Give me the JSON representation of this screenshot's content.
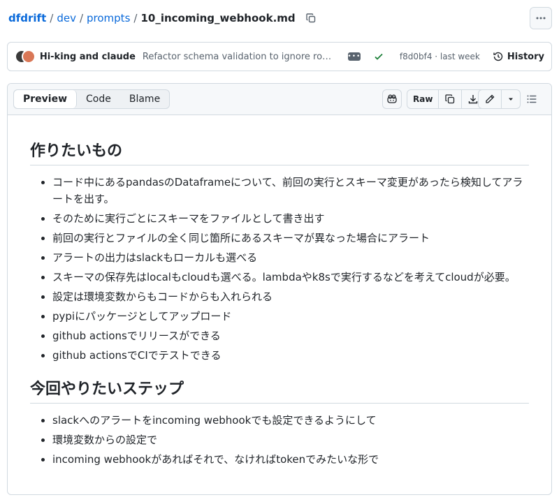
{
  "breadcrumb": {
    "owner": "dfdrift",
    "dir1": "dev",
    "dir2": "prompts",
    "file": "10_incoming_webhook.md",
    "sep": "/"
  },
  "commit": {
    "authors": "Hi-king and claude",
    "message": "Refactor schema validation to ignore row cou...",
    "sha_time": "f8d0bf4 · last week",
    "history_label": "History",
    "ellipsis": "•••"
  },
  "toolbar": {
    "tabs": [
      "Preview",
      "Code",
      "Blame"
    ],
    "raw_label": "Raw"
  },
  "content": {
    "heading1": "作りたいもの",
    "list1": [
      "コード中にあるpandasのDataframeについて、前回の実行とスキーマ変更があったら検知してアラートを出す。",
      "そのために実行ごとにスキーマをファイルとして書き出す",
      "前回の実行とファイルの全く同じ箇所にあるスキーマが異なった場合にアラート",
      "アラートの出力はslackもローカルも選べる",
      "スキーマの保存先はlocalもcloudも選べる。lambdaやk8sで実行するなどを考えてcloudが必要。",
      "設定は環境変数からもコードからも入れられる",
      "pypiにパッケージとしてアップロード",
      "github actionsでリリースができる",
      "github actionsでCIでテストできる"
    ],
    "heading2": "今回やりたいステップ",
    "list2": [
      "slackへのアラートをincoming webhookでも設定できるようにして",
      "環境変数からの設定で",
      "incoming webhookがあればそれで、なければtokenでみたいな形で"
    ]
  },
  "colors": {
    "link": "#0969da",
    "check": "#1a7f37",
    "border": "#d1d9e0"
  }
}
